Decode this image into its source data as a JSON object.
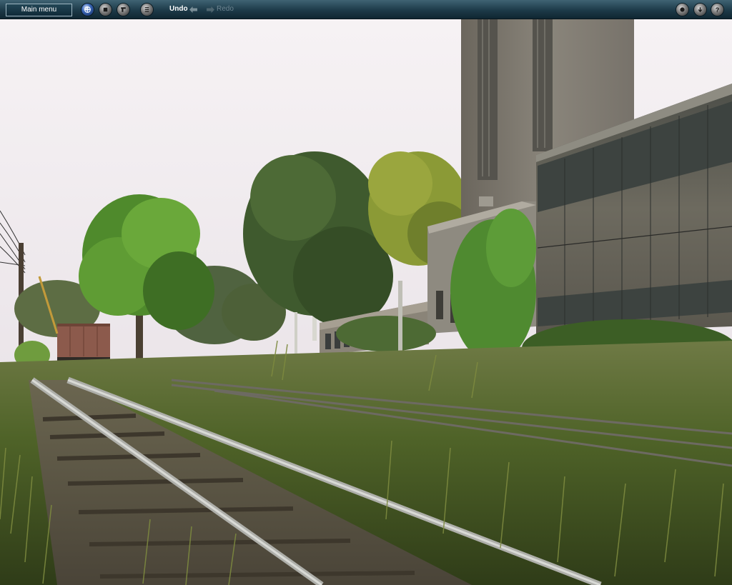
{
  "toolbar": {
    "main_menu_label": "Main menu",
    "undo_label": "Undo",
    "redo_label": "Redo",
    "left_icons": [
      "globe-icon",
      "stop-icon",
      "paint-icon",
      "list-icon"
    ],
    "right_icons": [
      "camera-icon",
      "minimize-icon",
      "help-icon"
    ]
  },
  "colors": {
    "toolbar_top": "#3f6373",
    "toolbar_bottom": "#0f2631",
    "sky": "#ece6ea",
    "grass": "#556a2c",
    "rail": "#a3a4a0",
    "building": "#6f6b62"
  }
}
